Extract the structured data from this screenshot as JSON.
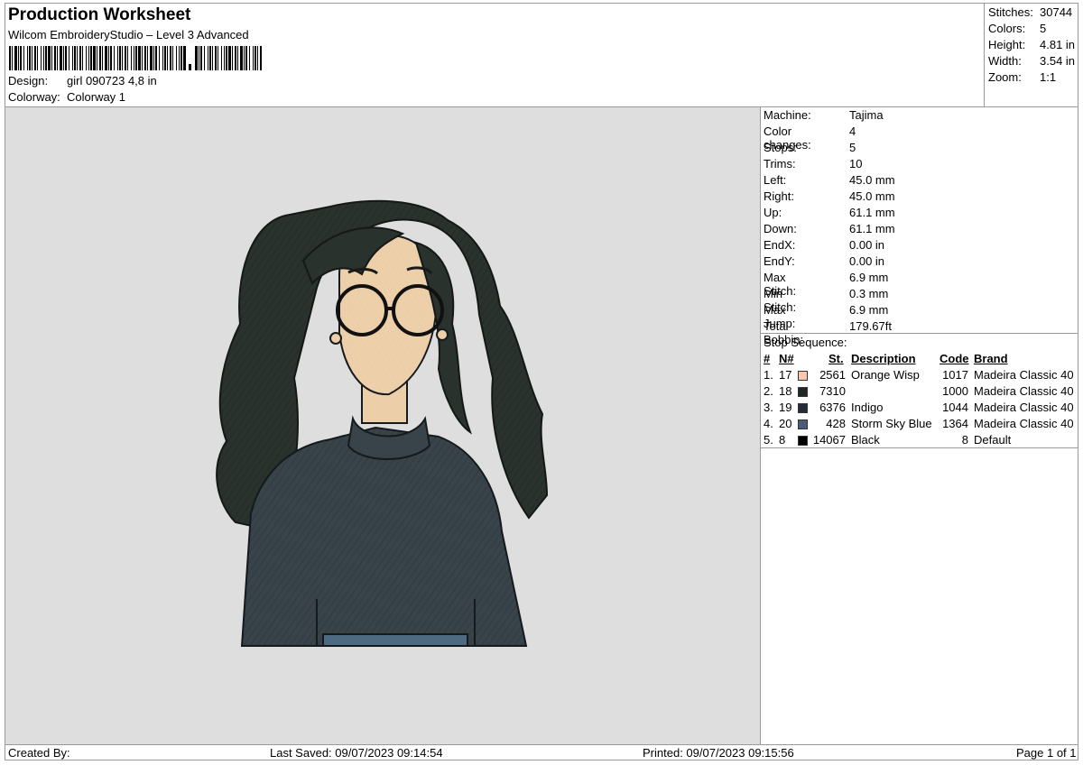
{
  "header": {
    "title": "Production Worksheet",
    "subtitle": "Wilcom EmbroideryStudio – Level 3 Advanced",
    "design_label": "Design:",
    "design_value": "girl 090723 4,8 in",
    "colorway_label": "Colorway:",
    "colorway_value": "Colorway 1"
  },
  "stats": [
    {
      "label": "Stitches:",
      "value": "30744"
    },
    {
      "label": "Colors:",
      "value": "5"
    },
    {
      "label": "Height:",
      "value": "4.81 in"
    },
    {
      "label": "Width:",
      "value": "3.54 in"
    },
    {
      "label": "Zoom:",
      "value": "1:1"
    }
  ],
  "machine_info": [
    {
      "label": "Machine:",
      "value": "Tajima"
    },
    {
      "label": "Color changes:",
      "value": "4"
    },
    {
      "label": "Stops:",
      "value": "5"
    },
    {
      "label": "Trims:",
      "value": "10"
    },
    {
      "label": "Left:",
      "value": "45.0 mm"
    },
    {
      "label": "Right:",
      "value": "45.0 mm"
    },
    {
      "label": "Up:",
      "value": "61.1 mm"
    },
    {
      "label": "Down:",
      "value": "61.1 mm"
    },
    {
      "label": "EndX:",
      "value": "0.00 in"
    },
    {
      "label": "EndY:",
      "value": "0.00 in"
    },
    {
      "label": "Max Stitch:",
      "value": "6.9 mm"
    },
    {
      "label": "Min Stitch:",
      "value": "0.3 mm"
    },
    {
      "label": "Max Jump:",
      "value": "6.9 mm"
    },
    {
      "label": "Total Bobbin:",
      "value": "179.67ft"
    }
  ],
  "stop_sequence": {
    "title": "Stop Sequence:",
    "headers": {
      "idx": "#",
      "n": "N#",
      "st": "St.",
      "desc": "Description",
      "code": "Code",
      "brand": "Brand"
    },
    "rows": [
      {
        "idx": "1.",
        "n": "17",
        "color": "#f6c8ad",
        "st": "2561",
        "desc": "Orange Wisp",
        "code": "1017",
        "brand": "Madeira Classic 40"
      },
      {
        "idx": "2.",
        "n": "18",
        "color": "#1f2624",
        "st": "7310",
        "desc": "",
        "code": "1000",
        "brand": "Madeira Classic 40"
      },
      {
        "idx": "3.",
        "n": "19",
        "color": "#242c38",
        "st": "6376",
        "desc": "Indigo",
        "code": "1044",
        "brand": "Madeira Classic 40"
      },
      {
        "idx": "4.",
        "n": "20",
        "color": "#4b5c78",
        "st": "428",
        "desc": "Storm Sky Blue",
        "code": "1364",
        "brand": "Madeira Classic 40"
      },
      {
        "idx": "5.",
        "n": "8",
        "color": "#000000",
        "st": "14067",
        "desc": "Black",
        "code": "8",
        "brand": "Default"
      }
    ]
  },
  "footer": {
    "created_by": "Created By:",
    "last_saved": "Last Saved: 09/07/2023 09:14:54",
    "printed": "Printed: 09/07/2023 09:15:56",
    "page": "Page 1 of 1"
  },
  "colors": {
    "canvas_bg": "#dedede",
    "skin": "#eccfa8",
    "hair": "#2a322d",
    "sweater": "#39434a",
    "jeans": "#4e6a80"
  }
}
